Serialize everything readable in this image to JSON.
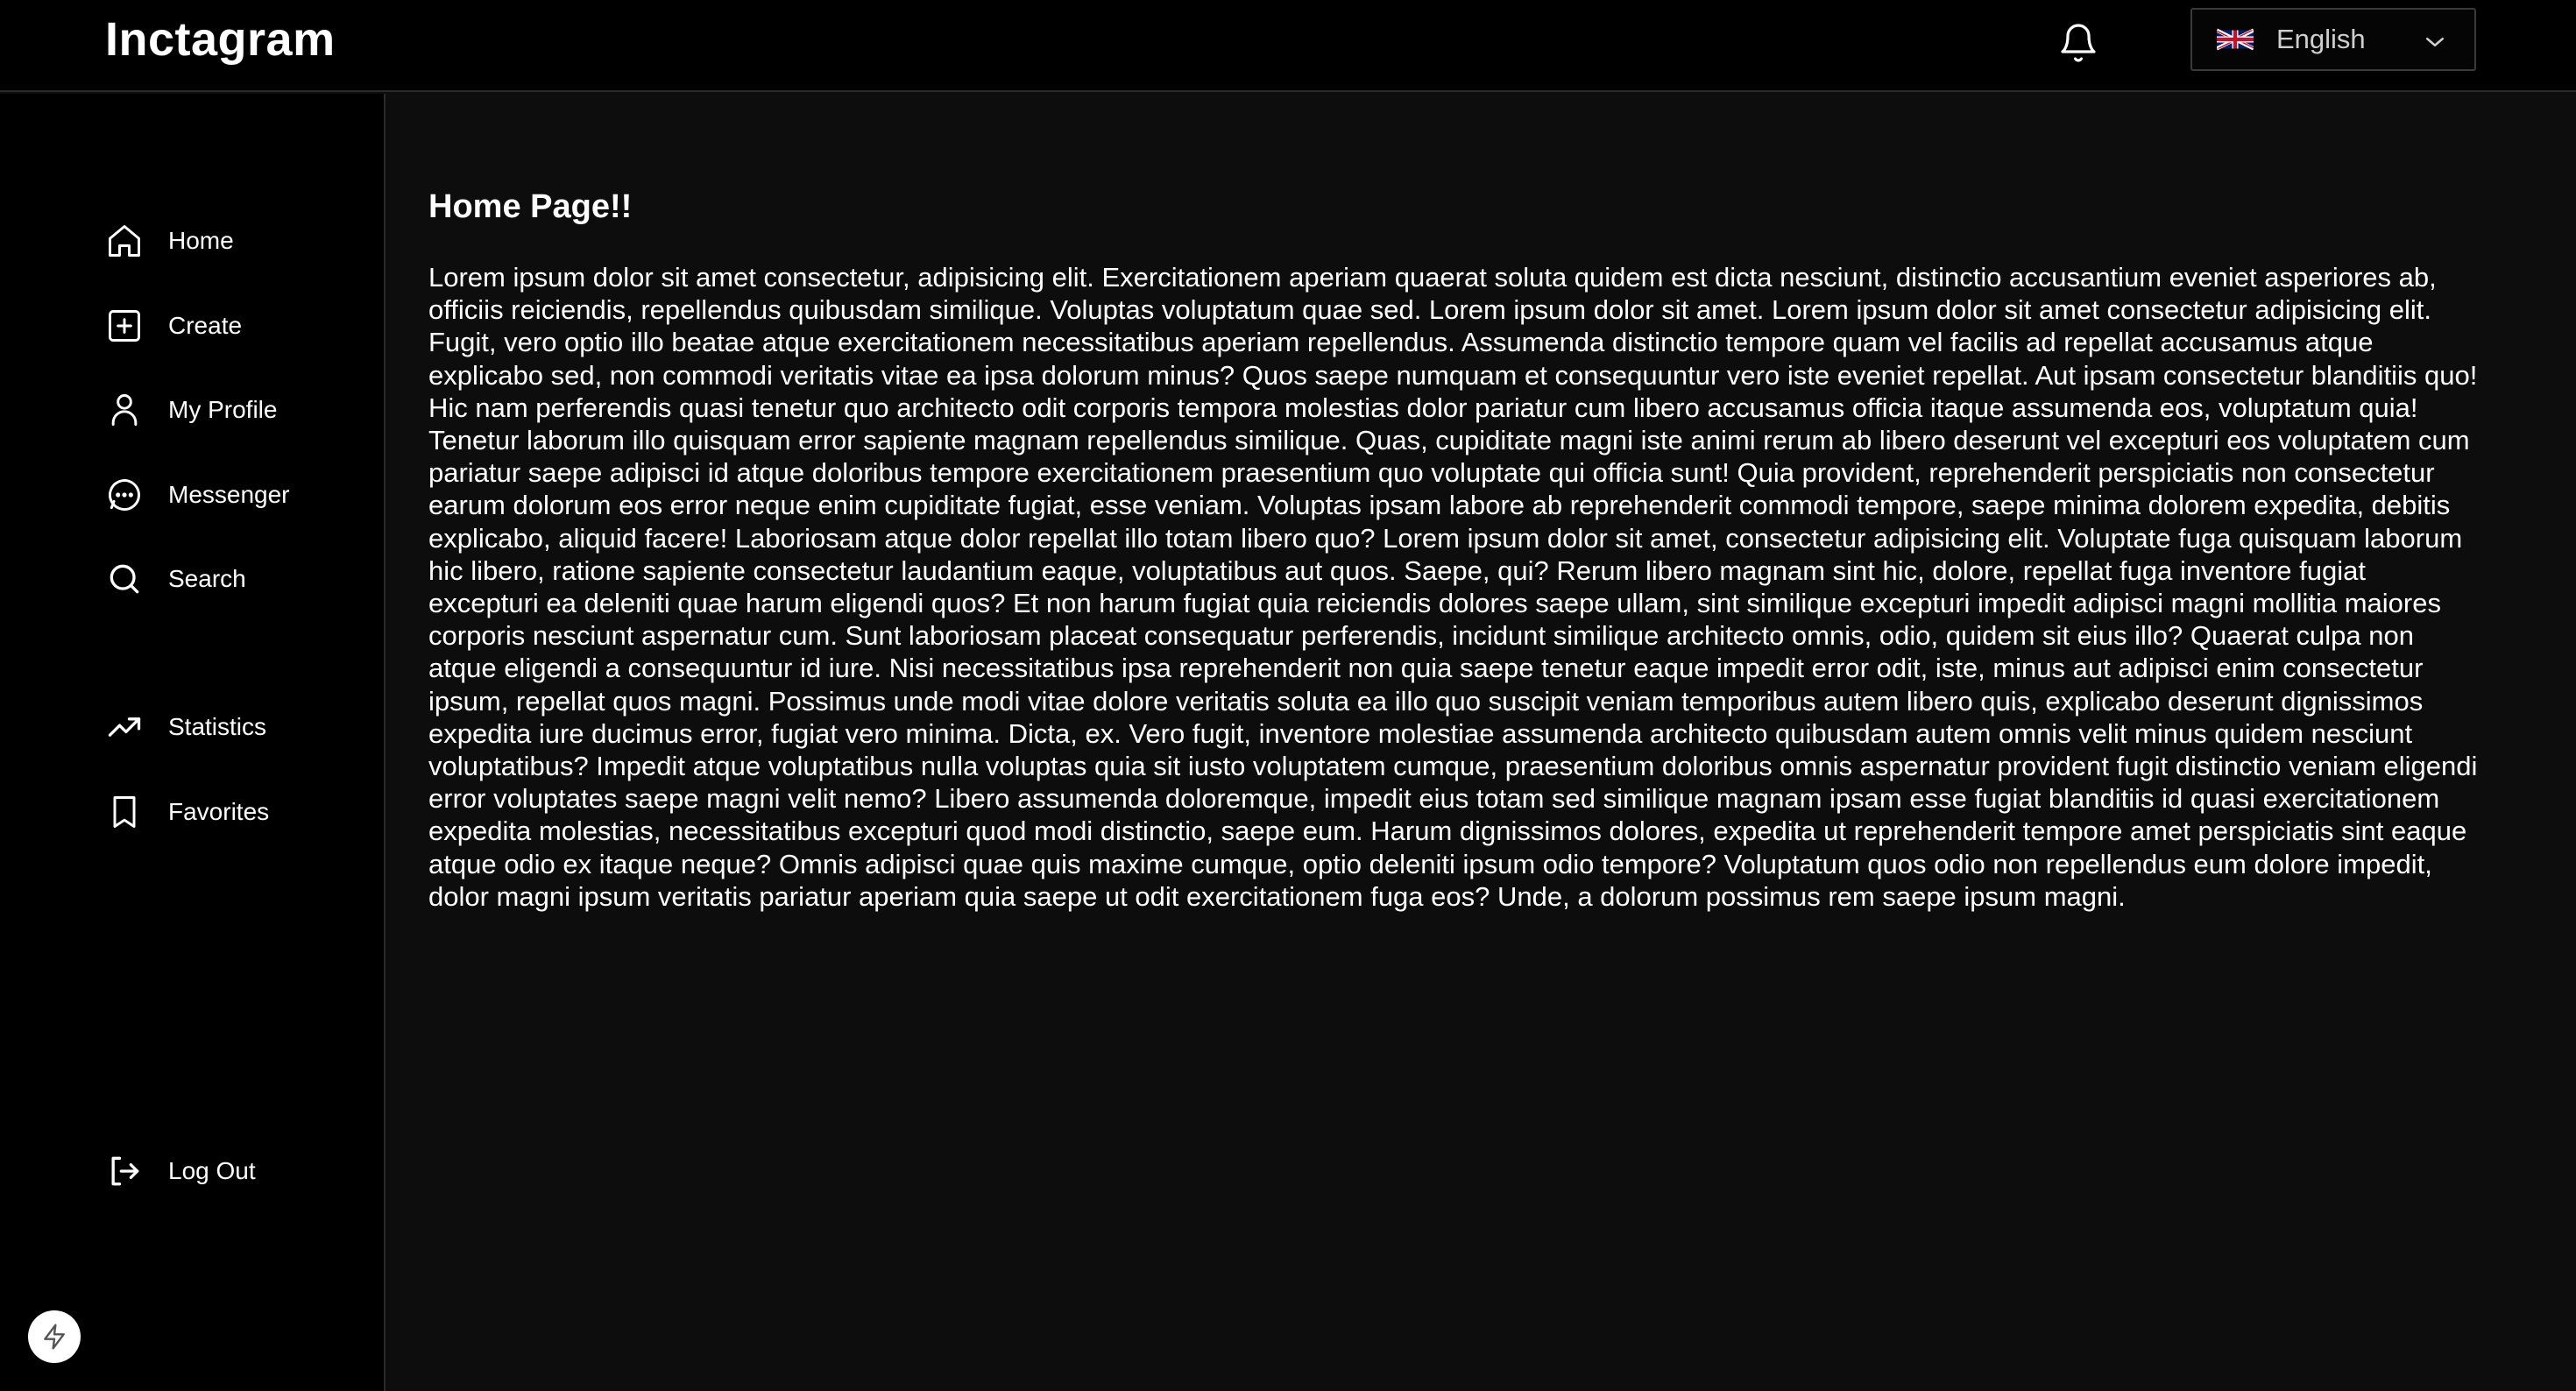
{
  "header": {
    "logo": "Inctagram",
    "language": {
      "label": "English",
      "flag_icon": "uk-flag-icon"
    },
    "notification_icon": "bell-icon"
  },
  "sidebar": {
    "items": [
      {
        "label": "Home",
        "icon": "home-icon"
      },
      {
        "label": "Create",
        "icon": "plus-square-icon"
      },
      {
        "label": "My Profile",
        "icon": "user-icon"
      },
      {
        "label": "Messenger",
        "icon": "message-icon"
      },
      {
        "label": "Search",
        "icon": "search-icon"
      },
      {
        "label": "Statistics",
        "icon": "trending-up-icon"
      },
      {
        "label": "Favorites",
        "icon": "bookmark-icon"
      }
    ],
    "logout": {
      "label": "Log Out",
      "icon": "logout-icon"
    }
  },
  "main": {
    "title": "Home Page!!",
    "body": "Lorem ipsum dolor sit amet consectetur, adipisicing elit. Exercitationem aperiam quaerat soluta quidem est dicta nesciunt, distinctio accusantium eveniet asperiores ab, officiis reiciendis, repellendus quibusdam similique. Voluptas voluptatum quae sed. Lorem ipsum dolor sit amet. Lorem ipsum dolor sit amet consectetur adipisicing elit. Fugit, vero optio illo beatae atque exercitationem necessitatibus aperiam repellendus. Assumenda distinctio tempore quam vel facilis ad repellat accusamus atque explicabo sed, non commodi veritatis vitae ea ipsa dolorum minus? Quos saepe numquam et consequuntur vero iste eveniet repellat. Aut ipsam consectetur blanditiis quo! Hic nam perferendis quasi tenetur quo architecto odit corporis tempora molestias dolor pariatur cum libero accusamus officia itaque assumenda eos, voluptatum quia! Tenetur laborum illo quisquam error sapiente magnam repellendus similique. Quas, cupiditate magni iste animi rerum ab libero deserunt vel excepturi eos voluptatem cum pariatur saepe adipisci id atque doloribus tempore exercitationem praesentium quo voluptate qui officia sunt! Quia provident, reprehenderit perspiciatis non consectetur earum dolorum eos error neque enim cupiditate fugiat, esse veniam. Voluptas ipsam labore ab reprehenderit commodi tempore, saepe minima dolorem expedita, debitis explicabo, aliquid facere! Laboriosam atque dolor repellat illo totam libero quo? Lorem ipsum dolor sit amet, consectetur adipisicing elit. Voluptate fuga quisquam laborum hic libero, ratione sapiente consectetur laudantium eaque, voluptatibus aut quos. Saepe, qui? Rerum libero magnam sint hic, dolore, repellat fuga inventore fugiat excepturi ea deleniti quae harum eligendi quos? Et non harum fugiat quia reiciendis dolores saepe ullam, sint similique excepturi impedit adipisci magni mollitia maiores corporis nesciunt aspernatur cum. Sunt laboriosam placeat consequatur perferendis, incidunt similique architecto omnis, odio, quidem sit eius illo? Quaerat culpa non atque eligendi a consequuntur id iure. Nisi necessitatibus ipsa reprehenderit non quia saepe tenetur eaque impedit error odit, iste, minus aut adipisci enim consectetur ipsum, repellat quos magni. Possimus unde modi vitae dolore veritatis soluta ea illo quo suscipit veniam temporibus autem libero quis, explicabo deserunt dignissimos expedita iure ducimus error, fugiat vero minima. Dicta, ex. Vero fugit, inventore molestiae assumenda architecto quibusdam autem omnis velit minus quidem nesciunt voluptatibus? Impedit atque voluptatibus nulla voluptas quia sit iusto voluptatem cumque, praesentium doloribus omnis aspernatur provident fugit distinctio veniam eligendi error voluptates saepe magni velit nemo? Libero assumenda doloremque, impedit eius totam sed similique magnam ipsam esse fugiat blanditiis id quasi exercitationem expedita molestias, necessitatibus excepturi quod modi distinctio, saepe eum. Harum dignissimos dolores, expedita ut reprehenderit tempore amet perspiciatis sint eaque atque odio ex itaque neque? Omnis adipisci quae quis maxime cumque, optio deleniti ipsum odio tempore? Voluptatum quos odio non repellendus eum dolore impedit, dolor magni ipsum veritatis pariatur aperiam quia saepe ut odit exercitationem fuga eos? Unde, a dolorum possimus rem saepe ipsum magni."
  },
  "devtools": {
    "icon": "bolt-icon"
  },
  "colors": {
    "background": "#0d0d0d",
    "header_bg": "#000000",
    "sidebar_bg": "#000000",
    "border": "#2a2a2a",
    "text": "#ffffff"
  }
}
